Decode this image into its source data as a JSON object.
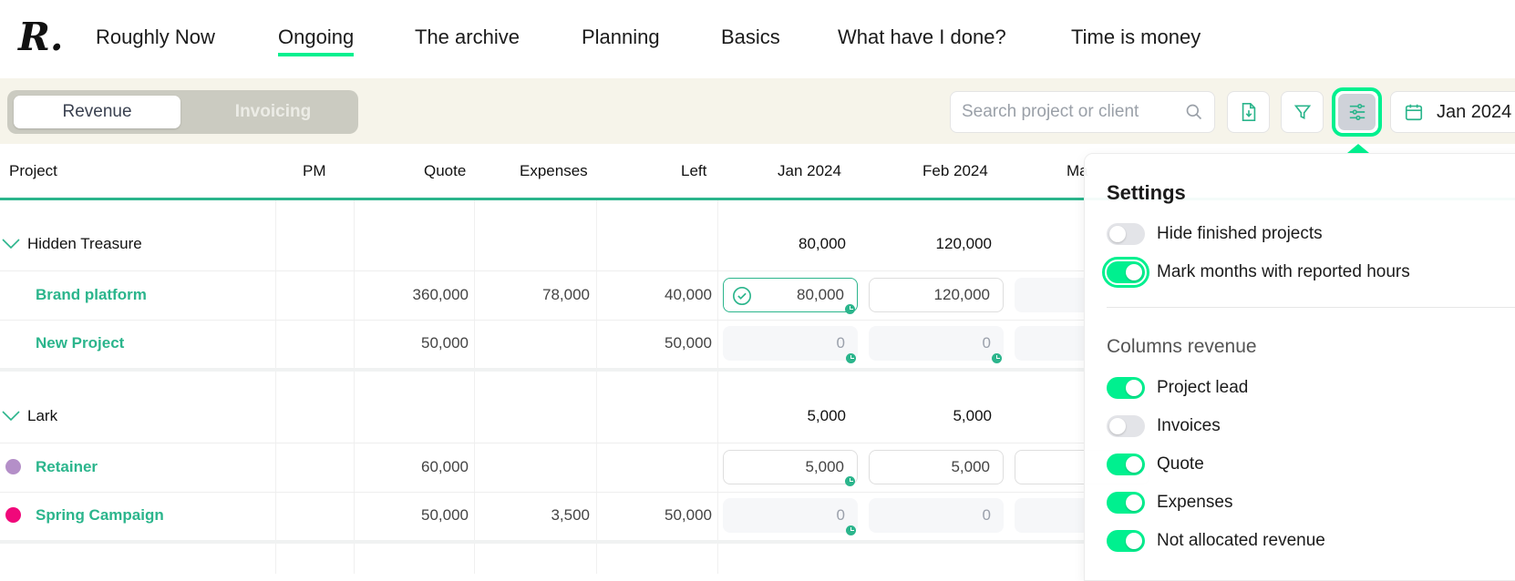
{
  "nav": {
    "logo": "R.",
    "items": [
      {
        "label": "Roughly Now",
        "active": false
      },
      {
        "label": "Ongoing",
        "active": true
      },
      {
        "label": "The archive",
        "active": false
      },
      {
        "label": "Planning",
        "active": false
      },
      {
        "label": "Basics",
        "active": false
      },
      {
        "label": "What have I done?",
        "active": false
      },
      {
        "label": "Time is money",
        "active": false
      }
    ]
  },
  "toolbar": {
    "tabs": [
      {
        "label": "Revenue",
        "selected": true
      },
      {
        "label": "Invoicing",
        "selected": false
      }
    ],
    "search_placeholder": "Search project or client",
    "date_label": "Jan 2024"
  },
  "table": {
    "headers": [
      "Project",
      "PM",
      "Quote",
      "Expenses",
      "Left",
      "Jan 2024",
      "Feb 2024",
      "Ma"
    ],
    "groups": [
      {
        "name": "Hidden Treasure",
        "jan": "80,000",
        "feb": "120,000",
        "projects": [
          {
            "name": "Brand platform",
            "quote": "360,000",
            "expenses": "78,000",
            "left": "40,000",
            "jan": "80,000",
            "feb": "120,000"
          },
          {
            "name": "New Project",
            "quote": "50,000",
            "expenses": "",
            "left": "50,000",
            "jan": "0",
            "feb": "0"
          }
        ]
      },
      {
        "name": "Lark",
        "jan": "5,000",
        "feb": "5,000",
        "projects": [
          {
            "name": "Retainer",
            "dot_color": "#b48fc8",
            "quote": "60,000",
            "expenses": "",
            "left": "",
            "jan": "5,000",
            "feb": "5,000"
          },
          {
            "name": "Spring Campaign",
            "dot_color": "#f0087a",
            "quote": "50,000",
            "expenses": "3,500",
            "left": "50,000",
            "jan": "0",
            "feb": "0"
          }
        ]
      }
    ]
  },
  "settings": {
    "title": "Settings",
    "options": [
      {
        "label": "Hide finished projects",
        "on": false
      },
      {
        "label": "Mark months with reported hours",
        "on": true
      }
    ],
    "columns_title": "Columns revenue",
    "columns": [
      {
        "label": "Project lead",
        "on": true
      },
      {
        "label": "Invoices",
        "on": false
      },
      {
        "label": "Quote",
        "on": true
      },
      {
        "label": "Expenses",
        "on": true
      },
      {
        "label": "Not allocated revenue",
        "on": true
      }
    ]
  },
  "colors": {
    "accent": "#00f08f",
    "green": "#2bb58c",
    "toolbar_bg": "#f6f4ea"
  }
}
